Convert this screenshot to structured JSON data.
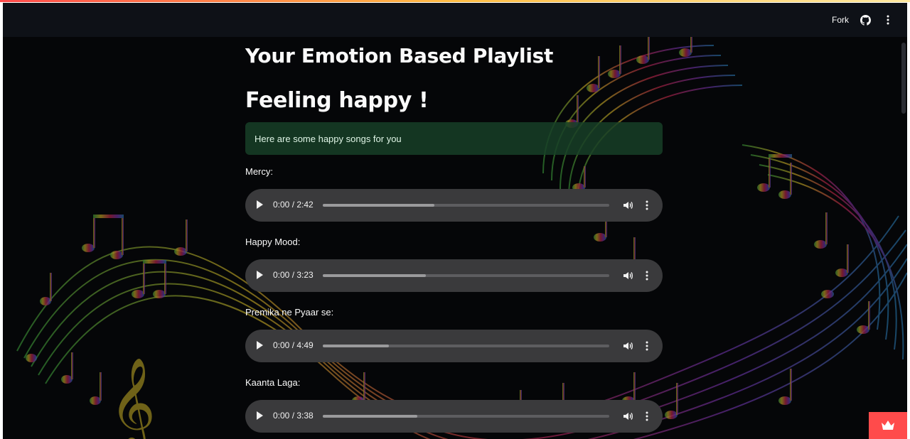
{
  "header": {
    "fork_label": "Fork",
    "github_icon": "github-icon",
    "menu_icon": "kebab-menu-icon"
  },
  "main": {
    "title": "Your Emotion Based Playlist",
    "feeling_heading": "Feeling happy !",
    "success_message": "Here are some happy songs for you"
  },
  "songs": [
    {
      "label": "Mercy:",
      "time": "0:00 / 2:42",
      "progress": 0.39
    },
    {
      "label": "Happy Mood:",
      "time": "0:00 / 3:23",
      "progress": 0.36
    },
    {
      "label": "Premika ne Pyaar se:",
      "time": "0:00 / 4:49",
      "progress": 0.23
    },
    {
      "label": "Kaanta Laga:",
      "time": "0:00 / 3:38",
      "progress": 0.33
    }
  ],
  "player_icons": {
    "play": "play-icon",
    "volume": "volume-icon",
    "more": "more-options-icon"
  },
  "badge_icon": "crown-icon",
  "colors": {
    "background": "#050608",
    "header": "#0e1117",
    "success_bg": "#174027",
    "player_bg": "#3a3a3c",
    "accent": "#ff4b4b"
  }
}
